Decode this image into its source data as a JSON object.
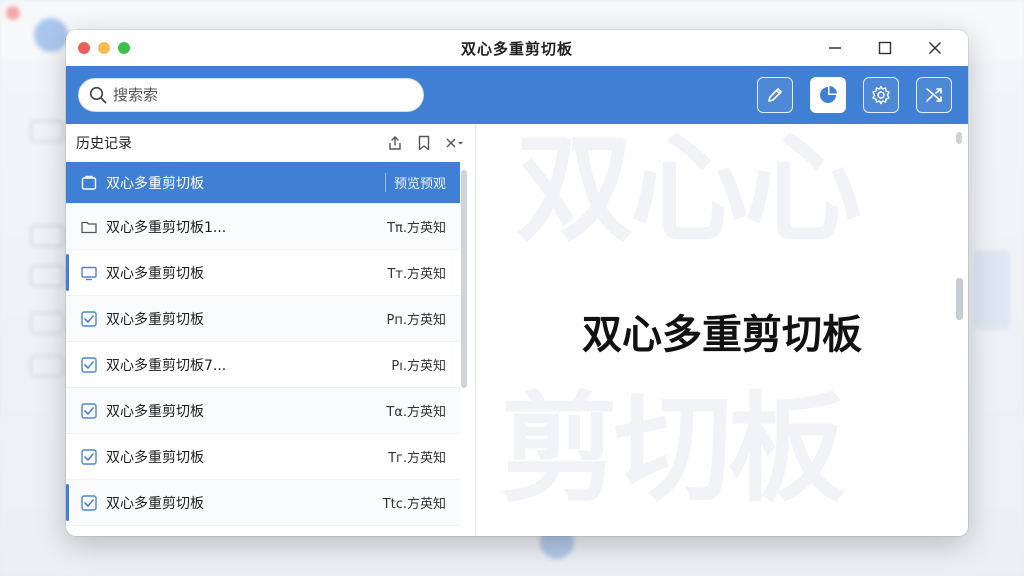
{
  "window": {
    "title": "双心多重剪切板"
  },
  "search": {
    "placeholder": "搜索索"
  },
  "toolbar": {
    "buttons": [
      {
        "icon": "pencil-icon",
        "active": false
      },
      {
        "icon": "pie-chart-icon",
        "active": true
      },
      {
        "icon": "gear-icon",
        "active": false
      },
      {
        "icon": "shuffle-icon",
        "active": false
      }
    ]
  },
  "history": {
    "title": "历史记录",
    "items": [
      {
        "icon": "clipboard-icon",
        "name": "双心多重剪切板",
        "meta": "预览预观",
        "selected": true
      },
      {
        "icon": "folder-icon",
        "name": "双心多重剪切板1...",
        "meta": "Tπ.方英知",
        "selected": false
      },
      {
        "icon": "monitor-icon",
        "name": "双心多重剪切板",
        "meta": "Tт.方英知",
        "selected": false
      },
      {
        "icon": "checkbox-icon",
        "name": "双心多重剪切板",
        "meta": "Pп.方英知",
        "selected": false
      },
      {
        "icon": "checkbox-icon",
        "name": "双心多重剪切板7...",
        "meta": "Pı.方英知",
        "selected": false
      },
      {
        "icon": "checkbox-icon",
        "name": "双心多重剪切板",
        "meta": "Tα.方英知",
        "selected": false
      },
      {
        "icon": "checkbox-icon",
        "name": "双心多重剪切板",
        "meta": "Tг.方英知",
        "selected": false
      },
      {
        "icon": "checkbox-icon",
        "name": "双心多重剪切板",
        "meta": "Ttc.方英知",
        "selected": false
      }
    ]
  },
  "preview": {
    "text": "双心多重剪切板",
    "watermark_top": "双心心",
    "watermark_bottom": "剪切板"
  },
  "colors": {
    "accent": "#3f7fd4"
  }
}
